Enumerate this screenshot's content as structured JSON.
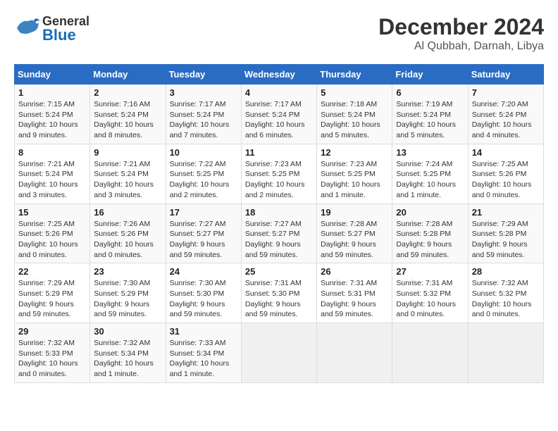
{
  "header": {
    "logo_general": "General",
    "logo_blue": "Blue",
    "main_title": "December 2024",
    "subtitle": "Al Qubbah, Darnah, Libya"
  },
  "calendar": {
    "days_of_week": [
      "Sunday",
      "Monday",
      "Tuesday",
      "Wednesday",
      "Thursday",
      "Friday",
      "Saturday"
    ],
    "weeks": [
      [
        {
          "day": "1",
          "sunrise": "7:15 AM",
          "sunset": "5:24 PM",
          "daylight": "10 hours and 9 minutes."
        },
        {
          "day": "2",
          "sunrise": "7:16 AM",
          "sunset": "5:24 PM",
          "daylight": "10 hours and 8 minutes."
        },
        {
          "day": "3",
          "sunrise": "7:17 AM",
          "sunset": "5:24 PM",
          "daylight": "10 hours and 7 minutes."
        },
        {
          "day": "4",
          "sunrise": "7:17 AM",
          "sunset": "5:24 PM",
          "daylight": "10 hours and 6 minutes."
        },
        {
          "day": "5",
          "sunrise": "7:18 AM",
          "sunset": "5:24 PM",
          "daylight": "10 hours and 5 minutes."
        },
        {
          "day": "6",
          "sunrise": "7:19 AM",
          "sunset": "5:24 PM",
          "daylight": "10 hours and 5 minutes."
        },
        {
          "day": "7",
          "sunrise": "7:20 AM",
          "sunset": "5:24 PM",
          "daylight": "10 hours and 4 minutes."
        }
      ],
      [
        {
          "day": "8",
          "sunrise": "7:21 AM",
          "sunset": "5:24 PM",
          "daylight": "10 hours and 3 minutes."
        },
        {
          "day": "9",
          "sunrise": "7:21 AM",
          "sunset": "5:24 PM",
          "daylight": "10 hours and 3 minutes."
        },
        {
          "day": "10",
          "sunrise": "7:22 AM",
          "sunset": "5:25 PM",
          "daylight": "10 hours and 2 minutes."
        },
        {
          "day": "11",
          "sunrise": "7:23 AM",
          "sunset": "5:25 PM",
          "daylight": "10 hours and 2 minutes."
        },
        {
          "day": "12",
          "sunrise": "7:23 AM",
          "sunset": "5:25 PM",
          "daylight": "10 hours and 1 minute."
        },
        {
          "day": "13",
          "sunrise": "7:24 AM",
          "sunset": "5:25 PM",
          "daylight": "10 hours and 1 minute."
        },
        {
          "day": "14",
          "sunrise": "7:25 AM",
          "sunset": "5:26 PM",
          "daylight": "10 hours and 0 minutes."
        }
      ],
      [
        {
          "day": "15",
          "sunrise": "7:25 AM",
          "sunset": "5:26 PM",
          "daylight": "10 hours and 0 minutes."
        },
        {
          "day": "16",
          "sunrise": "7:26 AM",
          "sunset": "5:26 PM",
          "daylight": "10 hours and 0 minutes."
        },
        {
          "day": "17",
          "sunrise": "7:27 AM",
          "sunset": "5:27 PM",
          "daylight": "9 hours and 59 minutes."
        },
        {
          "day": "18",
          "sunrise": "7:27 AM",
          "sunset": "5:27 PM",
          "daylight": "9 hours and 59 minutes."
        },
        {
          "day": "19",
          "sunrise": "7:28 AM",
          "sunset": "5:27 PM",
          "daylight": "9 hours and 59 minutes."
        },
        {
          "day": "20",
          "sunrise": "7:28 AM",
          "sunset": "5:28 PM",
          "daylight": "9 hours and 59 minutes."
        },
        {
          "day": "21",
          "sunrise": "7:29 AM",
          "sunset": "5:28 PM",
          "daylight": "9 hours and 59 minutes."
        }
      ],
      [
        {
          "day": "22",
          "sunrise": "7:29 AM",
          "sunset": "5:29 PM",
          "daylight": "9 hours and 59 minutes."
        },
        {
          "day": "23",
          "sunrise": "7:30 AM",
          "sunset": "5:29 PM",
          "daylight": "9 hours and 59 minutes."
        },
        {
          "day": "24",
          "sunrise": "7:30 AM",
          "sunset": "5:30 PM",
          "daylight": "9 hours and 59 minutes."
        },
        {
          "day": "25",
          "sunrise": "7:31 AM",
          "sunset": "5:30 PM",
          "daylight": "9 hours and 59 minutes."
        },
        {
          "day": "26",
          "sunrise": "7:31 AM",
          "sunset": "5:31 PM",
          "daylight": "9 hours and 59 minutes."
        },
        {
          "day": "27",
          "sunrise": "7:31 AM",
          "sunset": "5:32 PM",
          "daylight": "10 hours and 0 minutes."
        },
        {
          "day": "28",
          "sunrise": "7:32 AM",
          "sunset": "5:32 PM",
          "daylight": "10 hours and 0 minutes."
        }
      ],
      [
        {
          "day": "29",
          "sunrise": "7:32 AM",
          "sunset": "5:33 PM",
          "daylight": "10 hours and 0 minutes."
        },
        {
          "day": "30",
          "sunrise": "7:32 AM",
          "sunset": "5:34 PM",
          "daylight": "10 hours and 1 minute."
        },
        {
          "day": "31",
          "sunrise": "7:33 AM",
          "sunset": "5:34 PM",
          "daylight": "10 hours and 1 minute."
        },
        null,
        null,
        null,
        null
      ]
    ]
  }
}
